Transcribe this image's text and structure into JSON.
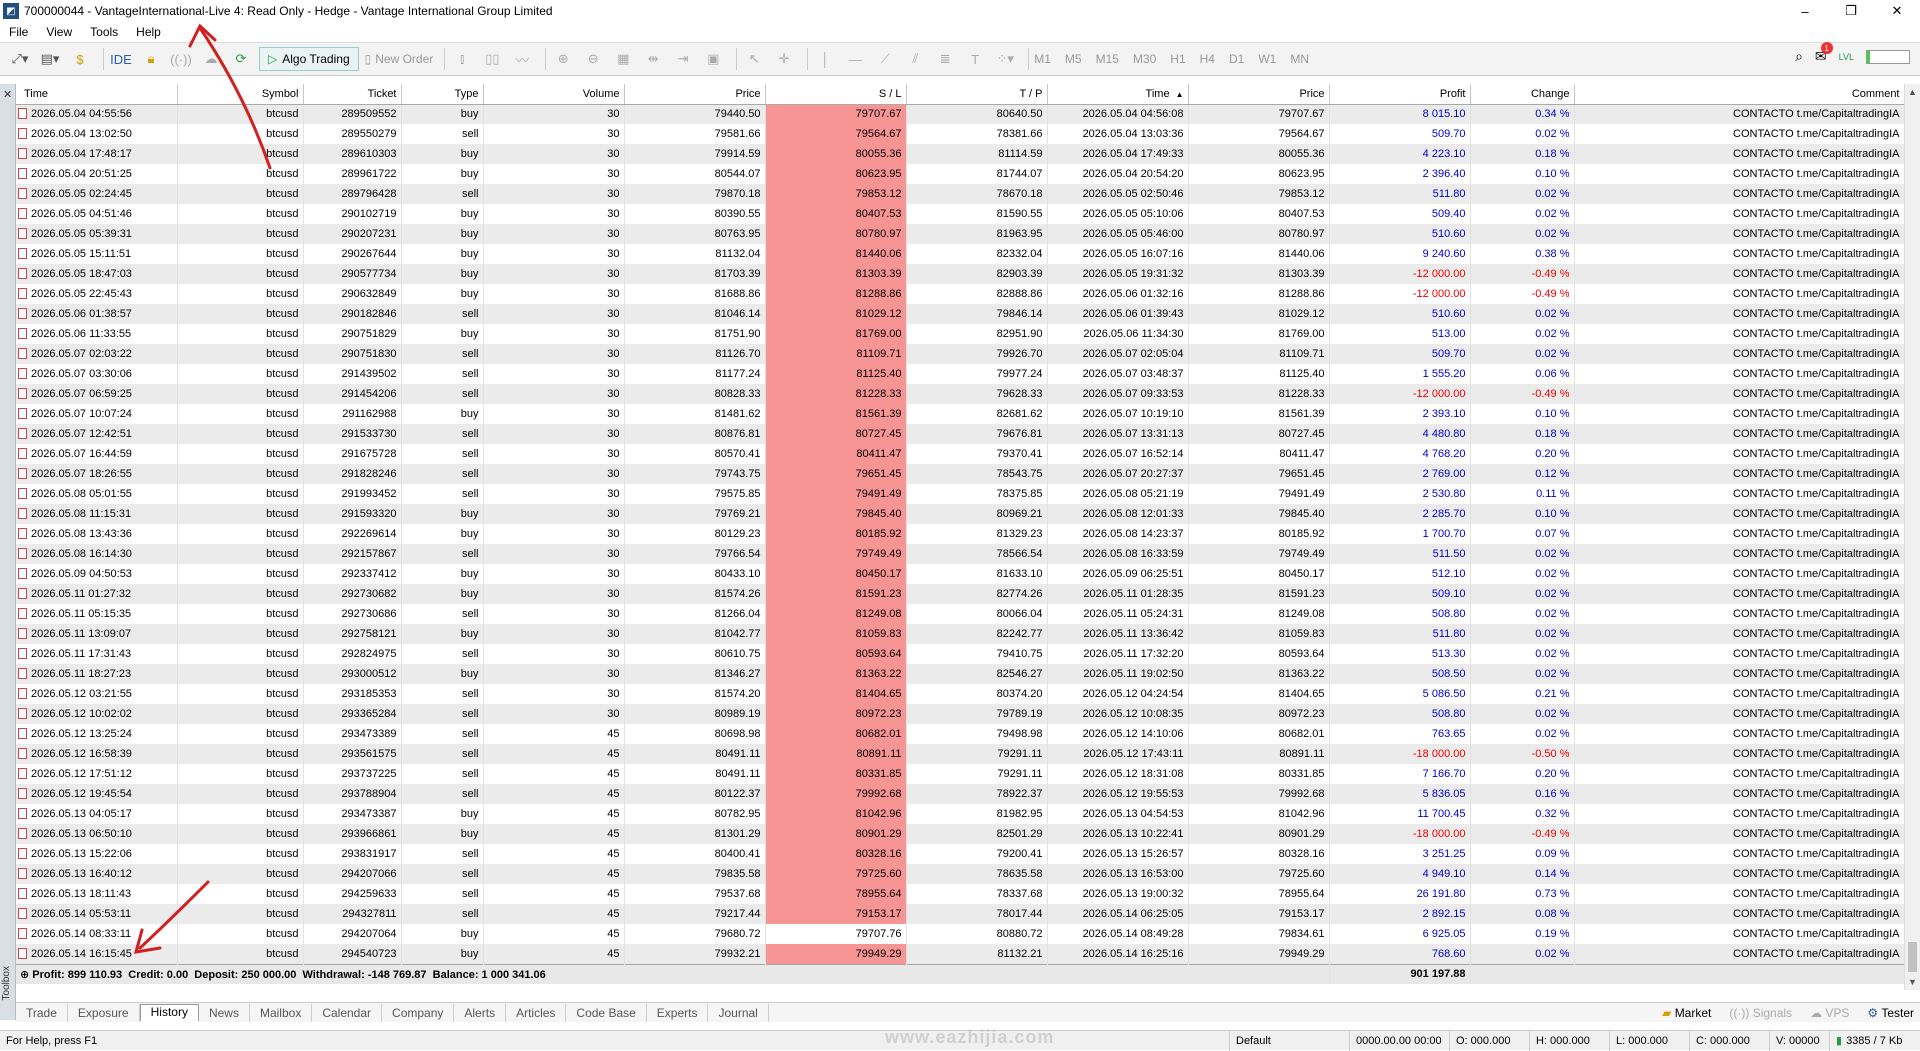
{
  "window": {
    "title": "700000044 - VantageInternational-Live 4: Read Only - Hedge - Vantage International Group Limited",
    "min": "–",
    "max": "❐",
    "close": "✕"
  },
  "menu": [
    "File",
    "View",
    "Tools",
    "Help"
  ],
  "toolbar": {
    "ide_label": "IDE",
    "algo_label": "Algo Trading",
    "new_order_label": "New Order",
    "timeframes": [
      "M1",
      "M5",
      "M15",
      "M30",
      "H1",
      "H4",
      "D1",
      "W1",
      "MN"
    ],
    "notification_count": "1",
    "lvl_label": "LVL"
  },
  "columns": [
    "Time",
    "Symbol",
    "Ticket",
    "Type",
    "Volume",
    "Price",
    "S / L",
    "T / P",
    "Time",
    "Price",
    "Profit",
    "Change",
    "Comment"
  ],
  "sort_indicator": "▲",
  "rows": [
    [
      "2026.05.04 04:55:56",
      "btcusd",
      "289509552",
      "buy",
      "30",
      "79440.50",
      "79707.67",
      "80640.50",
      "2026.05.04 04:56:08",
      "79707.67",
      "8 015.10",
      "0.34 %",
      "CONTACTO t.me/CapitaltradingIA"
    ],
    [
      "2026.05.04 13:02:50",
      "btcusd",
      "289550279",
      "sell",
      "30",
      "79581.66",
      "79564.67",
      "78381.66",
      "2026.05.04 13:03:36",
      "79564.67",
      "509.70",
      "0.02 %",
      "CONTACTO t.me/CapitaltradingIA"
    ],
    [
      "2026.05.04 17:48:17",
      "btcusd",
      "289610303",
      "buy",
      "30",
      "79914.59",
      "80055.36",
      "81114.59",
      "2026.05.04 17:49:33",
      "80055.36",
      "4 223.10",
      "0.18 %",
      "CONTACTO t.me/CapitaltradingIA"
    ],
    [
      "2026.05.04 20:51:25",
      "btcusd",
      "289961722",
      "buy",
      "30",
      "80544.07",
      "80623.95",
      "81744.07",
      "2026.05.04 20:54:20",
      "80623.95",
      "2 396.40",
      "0.10 %",
      "CONTACTO t.me/CapitaltradingIA"
    ],
    [
      "2026.05.05 02:24:45",
      "btcusd",
      "289796428",
      "sell",
      "30",
      "79870.18",
      "79853.12",
      "78670.18",
      "2026.05.05 02:50:46",
      "79853.12",
      "511.80",
      "0.02 %",
      "CONTACTO t.me/CapitaltradingIA"
    ],
    [
      "2026.05.05 04:51:46",
      "btcusd",
      "290102719",
      "buy",
      "30",
      "80390.55",
      "80407.53",
      "81590.55",
      "2026.05.05 05:10:06",
      "80407.53",
      "509.40",
      "0.02 %",
      "CONTACTO t.me/CapitaltradingIA"
    ],
    [
      "2026.05.05 05:39:31",
      "btcusd",
      "290207231",
      "buy",
      "30",
      "80763.95",
      "80780.97",
      "81963.95",
      "2026.05.05 05:46:00",
      "80780.97",
      "510.60",
      "0.02 %",
      "CONTACTO t.me/CapitaltradingIA"
    ],
    [
      "2026.05.05 15:11:51",
      "btcusd",
      "290267644",
      "buy",
      "30",
      "81132.04",
      "81440.06",
      "82332.04",
      "2026.05.05 16:07:16",
      "81440.06",
      "9 240.60",
      "0.38 %",
      "CONTACTO t.me/CapitaltradingIA"
    ],
    [
      "2026.05.05 18:47:03",
      "btcusd",
      "290577734",
      "buy",
      "30",
      "81703.39",
      "81303.39",
      "82903.39",
      "2026.05.05 19:31:32",
      "81303.39",
      "-12 000.00",
      "-0.49 %",
      "CONTACTO t.me/CapitaltradingIA"
    ],
    [
      "2026.05.05 22:45:43",
      "btcusd",
      "290632849",
      "buy",
      "30",
      "81688.86",
      "81288.86",
      "82888.86",
      "2026.05.06 01:32:16",
      "81288.86",
      "-12 000.00",
      "-0.49 %",
      "CONTACTO t.me/CapitaltradingIA"
    ],
    [
      "2026.05.06 01:38:57",
      "btcusd",
      "290182846",
      "sell",
      "30",
      "81046.14",
      "81029.12",
      "79846.14",
      "2026.05.06 01:39:43",
      "81029.12",
      "510.60",
      "0.02 %",
      "CONTACTO t.me/CapitaltradingIA"
    ],
    [
      "2026.05.06 11:33:55",
      "btcusd",
      "290751829",
      "buy",
      "30",
      "81751.90",
      "81769.00",
      "82951.90",
      "2026.05.06 11:34:30",
      "81769.00",
      "513.00",
      "0.02 %",
      "CONTACTO t.me/CapitaltradingIA"
    ],
    [
      "2026.05.07 02:03:22",
      "btcusd",
      "290751830",
      "sell",
      "30",
      "81126.70",
      "81109.71",
      "79926.70",
      "2026.05.07 02:05:04",
      "81109.71",
      "509.70",
      "0.02 %",
      "CONTACTO t.me/CapitaltradingIA"
    ],
    [
      "2026.05.07 03:30:06",
      "btcusd",
      "291439502",
      "sell",
      "30",
      "81177.24",
      "81125.40",
      "79977.24",
      "2026.05.07 03:48:37",
      "81125.40",
      "1 555.20",
      "0.06 %",
      "CONTACTO t.me/CapitaltradingIA"
    ],
    [
      "2026.05.07 06:59:25",
      "btcusd",
      "291454206",
      "sell",
      "30",
      "80828.33",
      "81228.33",
      "79628.33",
      "2026.05.07 09:33:53",
      "81228.33",
      "-12 000.00",
      "-0.49 %",
      "CONTACTO t.me/CapitaltradingIA"
    ],
    [
      "2026.05.07 10:07:24",
      "btcusd",
      "291162988",
      "buy",
      "30",
      "81481.62",
      "81561.39",
      "82681.62",
      "2026.05.07 10:19:10",
      "81561.39",
      "2 393.10",
      "0.10 %",
      "CONTACTO t.me/CapitaltradingIA"
    ],
    [
      "2026.05.07 12:42:51",
      "btcusd",
      "291533730",
      "sell",
      "30",
      "80876.81",
      "80727.45",
      "79676.81",
      "2026.05.07 13:31:13",
      "80727.45",
      "4 480.80",
      "0.18 %",
      "CONTACTO t.me/CapitaltradingIA"
    ],
    [
      "2026.05.07 16:44:59",
      "btcusd",
      "291675728",
      "sell",
      "30",
      "80570.41",
      "80411.47",
      "79370.41",
      "2026.05.07 16:52:14",
      "80411.47",
      "4 768.20",
      "0.20 %",
      "CONTACTO t.me/CapitaltradingIA"
    ],
    [
      "2026.05.07 18:26:55",
      "btcusd",
      "291828246",
      "sell",
      "30",
      "79743.75",
      "79651.45",
      "78543.75",
      "2026.05.07 20:27:37",
      "79651.45",
      "2 769.00",
      "0.12 %",
      "CONTACTO t.me/CapitaltradingIA"
    ],
    [
      "2026.05.08 05:01:55",
      "btcusd",
      "291993452",
      "sell",
      "30",
      "79575.85",
      "79491.49",
      "78375.85",
      "2026.05.08 05:21:19",
      "79491.49",
      "2 530.80",
      "0.11 %",
      "CONTACTO t.me/CapitaltradingIA"
    ],
    [
      "2026.05.08 11:15:31",
      "btcusd",
      "291593320",
      "buy",
      "30",
      "79769.21",
      "79845.40",
      "80969.21",
      "2026.05.08 12:01:33",
      "79845.40",
      "2 285.70",
      "0.10 %",
      "CONTACTO t.me/CapitaltradingIA"
    ],
    [
      "2026.05.08 13:43:36",
      "btcusd",
      "292269614",
      "buy",
      "30",
      "80129.23",
      "80185.92",
      "81329.23",
      "2026.05.08 14:23:37",
      "80185.92",
      "1 700.70",
      "0.07 %",
      "CONTACTO t.me/CapitaltradingIA"
    ],
    [
      "2026.05.08 16:14:30",
      "btcusd",
      "292157867",
      "sell",
      "30",
      "79766.54",
      "79749.49",
      "78566.54",
      "2026.05.08 16:33:59",
      "79749.49",
      "511.50",
      "0.02 %",
      "CONTACTO t.me/CapitaltradingIA"
    ],
    [
      "2026.05.09 04:50:53",
      "btcusd",
      "292337412",
      "buy",
      "30",
      "80433.10",
      "80450.17",
      "81633.10",
      "2026.05.09 06:25:51",
      "80450.17",
      "512.10",
      "0.02 %",
      "CONTACTO t.me/CapitaltradingIA"
    ],
    [
      "2026.05.11 01:27:32",
      "btcusd",
      "292730682",
      "buy",
      "30",
      "81574.26",
      "81591.23",
      "82774.26",
      "2026.05.11 01:28:35",
      "81591.23",
      "509.10",
      "0.02 %",
      "CONTACTO t.me/CapitaltradingIA"
    ],
    [
      "2026.05.11 05:15:35",
      "btcusd",
      "292730686",
      "sell",
      "30",
      "81266.04",
      "81249.08",
      "80066.04",
      "2026.05.11 05:24:31",
      "81249.08",
      "508.80",
      "0.02 %",
      "CONTACTO t.me/CapitaltradingIA"
    ],
    [
      "2026.05.11 13:09:07",
      "btcusd",
      "292758121",
      "buy",
      "30",
      "81042.77",
      "81059.83",
      "82242.77",
      "2026.05.11 13:36:42",
      "81059.83",
      "511.80",
      "0.02 %",
      "CONTACTO t.me/CapitaltradingIA"
    ],
    [
      "2026.05.11 17:31:43",
      "btcusd",
      "292824975",
      "sell",
      "30",
      "80610.75",
      "80593.64",
      "79410.75",
      "2026.05.11 17:32:20",
      "80593.64",
      "513.30",
      "0.02 %",
      "CONTACTO t.me/CapitaltradingIA"
    ],
    [
      "2026.05.11 18:27:23",
      "btcusd",
      "293000512",
      "buy",
      "30",
      "81346.27",
      "81363.22",
      "82546.27",
      "2026.05.11 19:02:50",
      "81363.22",
      "508.50",
      "0.02 %",
      "CONTACTO t.me/CapitaltradingIA"
    ],
    [
      "2026.05.12 03:21:55",
      "btcusd",
      "293185353",
      "sell",
      "30",
      "81574.20",
      "81404.65",
      "80374.20",
      "2026.05.12 04:24:54",
      "81404.65",
      "5 086.50",
      "0.21 %",
      "CONTACTO t.me/CapitaltradingIA"
    ],
    [
      "2026.05.12 10:02:02",
      "btcusd",
      "293365284",
      "sell",
      "30",
      "80989.19",
      "80972.23",
      "79789.19",
      "2026.05.12 10:08:35",
      "80972.23",
      "508.80",
      "0.02 %",
      "CONTACTO t.me/CapitaltradingIA"
    ],
    [
      "2026.05.12 13:25:24",
      "btcusd",
      "293473389",
      "sell",
      "45",
      "80698.98",
      "80682.01",
      "79498.98",
      "2026.05.12 14:10:06",
      "80682.01",
      "763.65",
      "0.02 %",
      "CONTACTO t.me/CapitaltradingIA"
    ],
    [
      "2026.05.12 16:58:39",
      "btcusd",
      "293561575",
      "sell",
      "45",
      "80491.11",
      "80891.11",
      "79291.11",
      "2026.05.12 17:43:11",
      "80891.11",
      "-18 000.00",
      "-0.50 %",
      "CONTACTO t.me/CapitaltradingIA"
    ],
    [
      "2026.05.12 17:51:12",
      "btcusd",
      "293737225",
      "sell",
      "45",
      "80491.11",
      "80331.85",
      "79291.11",
      "2026.05.12 18:31:08",
      "80331.85",
      "7 166.70",
      "0.20 %",
      "CONTACTO t.me/CapitaltradingIA"
    ],
    [
      "2026.05.12 19:45:54",
      "btcusd",
      "293788904",
      "sell",
      "45",
      "80122.37",
      "79992.68",
      "78922.37",
      "2026.05.12 19:55:53",
      "79992.68",
      "5 836.05",
      "0.16 %",
      "CONTACTO t.me/CapitaltradingIA"
    ],
    [
      "2026.05.13 04:05:17",
      "btcusd",
      "293473387",
      "buy",
      "45",
      "80782.95",
      "81042.96",
      "81982.95",
      "2026.05.13 04:54:53",
      "81042.96",
      "11 700.45",
      "0.32 %",
      "CONTACTO t.me/CapitaltradingIA"
    ],
    [
      "2026.05.13 06:50:10",
      "btcusd",
      "293966861",
      "buy",
      "45",
      "81301.29",
      "80901.29",
      "82501.29",
      "2026.05.13 10:22:41",
      "80901.29",
      "-18 000.00",
      "-0.49 %",
      "CONTACTO t.me/CapitaltradingIA"
    ],
    [
      "2026.05.13 15:22:06",
      "btcusd",
      "293831917",
      "sell",
      "45",
      "80400.41",
      "80328.16",
      "79200.41",
      "2026.05.13 15:26:57",
      "80328.16",
      "3 251.25",
      "0.09 %",
      "CONTACTO t.me/CapitaltradingIA"
    ],
    [
      "2026.05.13 16:40:12",
      "btcusd",
      "294207066",
      "sell",
      "45",
      "79835.58",
      "79725.60",
      "78635.58",
      "2026.05.13 16:53:00",
      "79725.60",
      "4 949.10",
      "0.14 %",
      "CONTACTO t.me/CapitaltradingIA"
    ],
    [
      "2026.05.13 18:11:43",
      "btcusd",
      "294259633",
      "sell",
      "45",
      "79537.68",
      "78955.64",
      "78337.68",
      "2026.05.13 19:00:32",
      "78955.64",
      "26 191.80",
      "0.73 %",
      "CONTACTO t.me/CapitaltradingIA"
    ],
    [
      "2026.05.14 05:53:11",
      "btcusd",
      "294327811",
      "sell",
      "45",
      "79217.44",
      "79153.17",
      "78017.44",
      "2026.05.14 06:25:05",
      "79153.17",
      "2 892.15",
      "0.08 %",
      "CONTACTO t.me/CapitaltradingIA"
    ],
    [
      "2026.05.14 08:33:11",
      "btcusd",
      "294207064",
      "buy",
      "45",
      "79680.72",
      "79707.76",
      "80880.72",
      "2026.05.14 08:49:28",
      "79834.61",
      "6 925.05",
      "0.19 %",
      "CONTACTO t.me/CapitaltradingIA"
    ],
    [
      "2026.05.14 16:15:45",
      "btcusd",
      "294540723",
      "buy",
      "45",
      "79932.21",
      "79949.29",
      "81132.21",
      "2026.05.14 16:25:16",
      "79949.29",
      "768.60",
      "0.02 %",
      "CONTACTO t.me/CapitaltradingIA"
    ]
  ],
  "summary": {
    "text": "Profit: 899 110.93  Credit: 0.00  Deposit: 250 000.00  Withdrawal: -148 769.87  Balance: 1 000 341.06",
    "total": "901 197.88"
  },
  "tabs": [
    "Trade",
    "Exposure",
    "History",
    "News",
    "Mailbox",
    "Calendar",
    "Company",
    "Alerts",
    "Articles",
    "Code Base",
    "Experts",
    "Journal"
  ],
  "active_tab": "History",
  "tabs_right": {
    "market": "Market",
    "signals": "Signals",
    "vps": "VPS",
    "tester": "Tester"
  },
  "toolbox_label": "Toolbox",
  "statusbar": {
    "help": "For Help, press F1",
    "profile": "Default",
    "datetime": "0000.00.00 00:00",
    "open": "O: 000.000",
    "high": "H: 000.000",
    "low": "L: 000.000",
    "close": "C: 000.000",
    "volume": "V: 00000",
    "traffic": "3385 / 7 Kb"
  },
  "watermark": "www.eazhijia.com",
  "colors": {
    "sl_highlight": "#f79494",
    "profit_positive": "#0000cc",
    "profit_negative": "#e00000",
    "annotation_arrow": "#d02020"
  }
}
